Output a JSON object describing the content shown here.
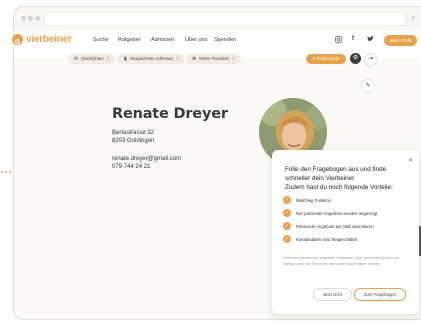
{
  "brand": {
    "name": "vierbeiner",
    "accent": "#e8a24c"
  },
  "nav": {
    "links": [
      "Suche",
      "Ratgeber",
      "Adressen",
      "Über uns",
      "Spenden"
    ],
    "social_icons": [
      "instagram-icon",
      "facebook-icon",
      "twitter-icon"
    ],
    "profile_button": "Mein Profil"
  },
  "subnav": {
    "items": [
      {
        "label": "Nachrichten",
        "count": "2",
        "icon": "mail-icon"
      },
      {
        "label": "Gespeicherte Adressen",
        "count": "3",
        "icon": "bookmark-icon"
      },
      {
        "label": "Meine Favoriten",
        "count": "5",
        "icon": "paw-icon"
      }
    ],
    "profile_button": "Profilansicht"
  },
  "profile": {
    "name": "Renate Dreyer",
    "street": "Bertastrasse 32",
    "city": "8203 Goldingen",
    "email": "renate.dreyer@gmail.com",
    "phone": "079 744 24 21"
  },
  "popup": {
    "title": "Fülle den Fragebogen aus und finde schneller dein Vierbeiner.",
    "subtitle": "Zudem hast du noch folgende Vorteile:",
    "benefits": [
      "Matching Funktion",
      "Nur passende Angebote werden angezeigt",
      "Passende Angebote per Mail abonnieren",
      "Kontaktdaten sind freigeschaltet"
    ],
    "note": "Tierheime können Ihre Angebote einspeisen. Bzw. sind diese für dich nur sichtbar wenn die Tierheime dies auch erlaubt haben können.",
    "later_button": "Jetzt nicht",
    "quiz_button": "Zum Fragebogen"
  }
}
